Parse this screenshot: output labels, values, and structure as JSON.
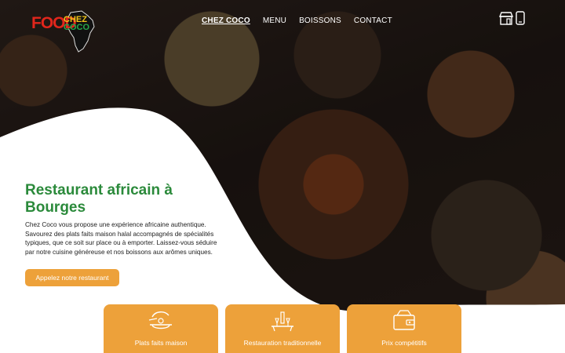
{
  "brand": {
    "logo_word_food": "FOOD",
    "logo_word_chez": "CHEZ",
    "logo_word_coco": "COCO",
    "colors": {
      "red": "#e1261c",
      "yellow": "#f0c419",
      "green": "#26a84a"
    }
  },
  "nav": {
    "items": [
      {
        "label": "CHEZ COCO",
        "active": true
      },
      {
        "label": "MENU",
        "active": false
      },
      {
        "label": "BOISSONS",
        "active": false
      },
      {
        "label": "CONTACT",
        "active": false
      }
    ],
    "icons": [
      "storefront-icon",
      "mobile-phone-icon"
    ]
  },
  "hero": {
    "title": "Restaurant africain à Bourges",
    "description": "Chez Coco vous propose une expérience africaine authentique. Savourez des plats faits maison halal accompagnés de spécialités typiques, que ce soit sur place ou à emporter. Laissez-vous séduire par notre cuisine généreuse et nos boissons aux arômes uniques.",
    "cta_label": "Appelez notre restaurant",
    "title_color": "#2b8a3b",
    "accent_color": "#eda13a"
  },
  "features": [
    {
      "label": "Plats faits maison",
      "icon": "serving-dish-icon"
    },
    {
      "label": "Restauration traditionnelle",
      "icon": "dining-table-icon"
    },
    {
      "label": "Prix compétitifs",
      "icon": "wallet-icon"
    }
  ]
}
